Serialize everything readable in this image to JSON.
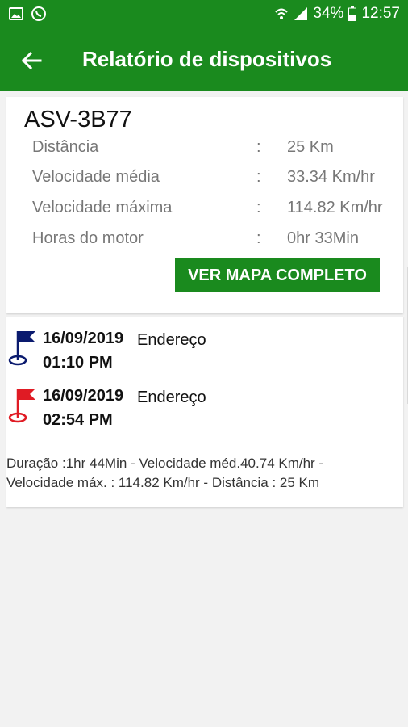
{
  "status_bar": {
    "battery": "34%",
    "time": "12:57"
  },
  "app_bar": {
    "title": "Relatório de dispositivos"
  },
  "device": {
    "plate": "ASV-3B77",
    "stats": [
      {
        "label": "Distância",
        "value": "25 Km"
      },
      {
        "label": "Velocidade média",
        "value": "33.34 Km/hr"
      },
      {
        "label": "Velocidade máxima",
        "value": "114.82 Km/hr"
      },
      {
        "label": "Horas do motor",
        "value": "0hr 33Min"
      }
    ],
    "separator": ":",
    "map_button": "VER MAPA COMPLETO"
  },
  "trip": {
    "start": {
      "date": "16/09/2019",
      "time": "01:10 PM",
      "address": "Endereço",
      "flag_color": "#0a1a6e"
    },
    "end": {
      "date": "16/09/2019",
      "time": "02:54 PM",
      "address": "Endereço",
      "flag_color": "#e01b24"
    },
    "summary_line1": "Duração :1hr 44Min - Velocidade méd.40.74 Km/hr -",
    "summary_line2": "Velocidade máx. : 114.82 Km/hr - Distância : 25 Km"
  },
  "colors": {
    "primary": "#1a8a1e"
  }
}
